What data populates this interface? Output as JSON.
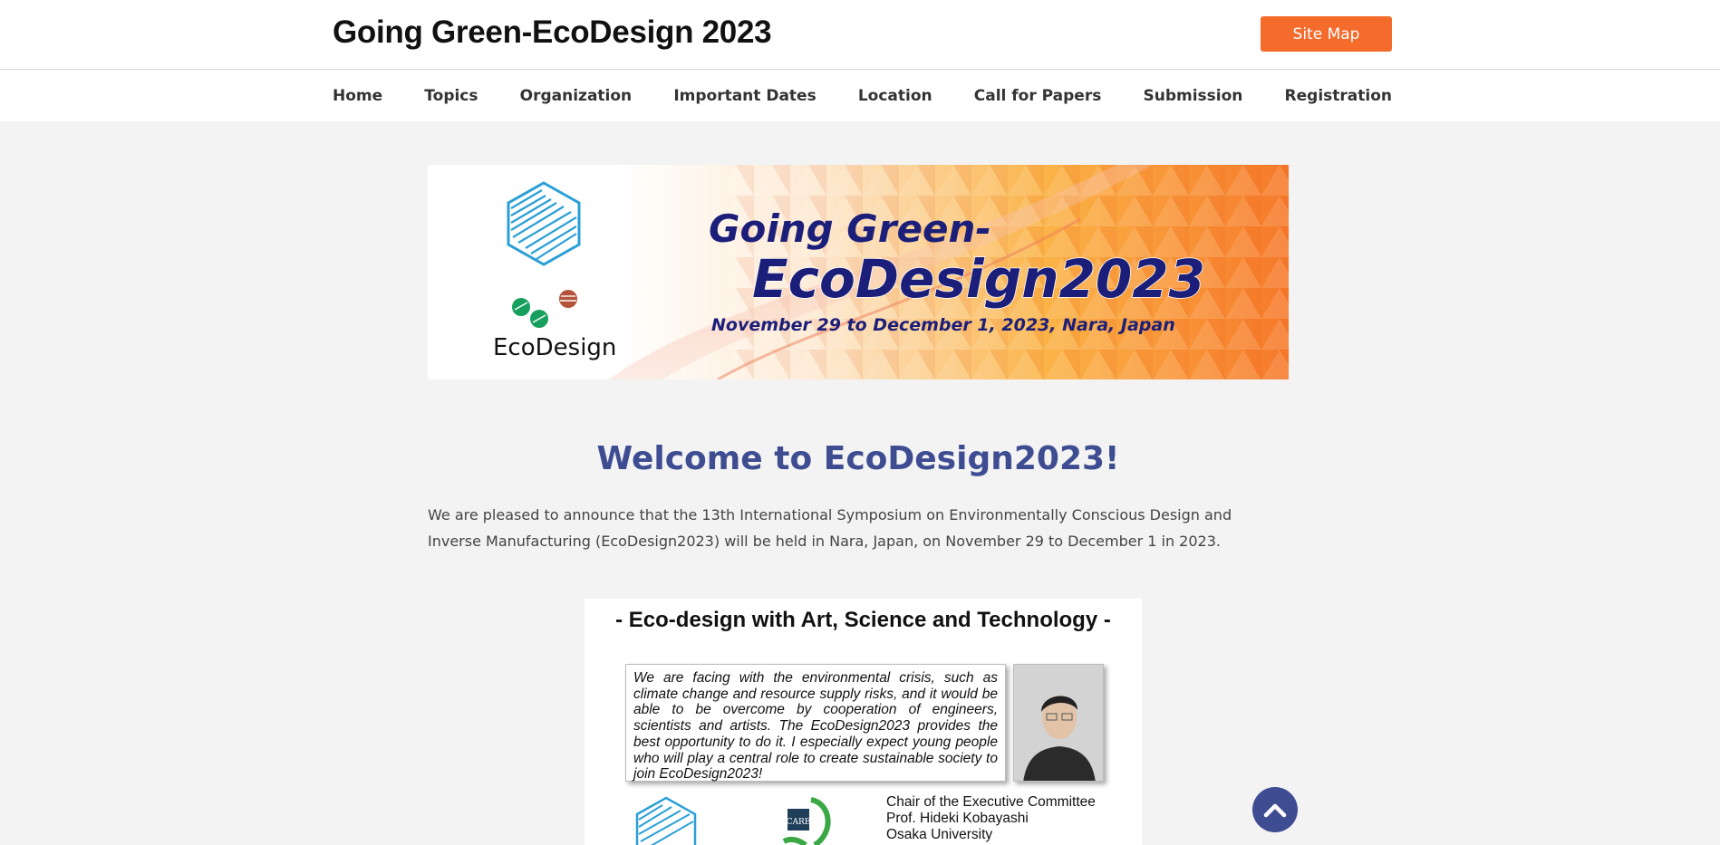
{
  "header": {
    "site_title": "Going Green-EcoDesign 2023",
    "sitemap_label": "Site Map"
  },
  "nav": {
    "items": [
      {
        "label": "Home"
      },
      {
        "label": "Topics"
      },
      {
        "label": "Organization"
      },
      {
        "label": "Important Dates"
      },
      {
        "label": "Location"
      },
      {
        "label": "Call for Papers"
      },
      {
        "label": "Submission"
      },
      {
        "label": "Registration"
      }
    ]
  },
  "banner": {
    "line1": "Going Green-",
    "line2": "EcoDesign2023",
    "dates": "November 29 to December 1, 2023, Nara, Japan",
    "logo_text": "EcoDesign"
  },
  "main": {
    "welcome_title": "Welcome to EcoDesign2023!",
    "intro_text": "We are pleased to announce that the 13th International Symposium on Environmentally Conscious Design and Inverse Manufacturing (EcoDesign2023) will be held in Nara, Japan, on November 29 to December 1 in 2023."
  },
  "poster": {
    "heading": "- Eco-design with Art, Science and Technology -",
    "quote": "We are facing with the environmental crisis, such as climate change and resource supply risks, and it would be able to be overcome by cooperation of engineers, scientists and artists. The EcoDesign2023 provides the best opportunity to do it. I especially expect young people who will play a central role to create sustainable society to join EcoDesign2023!",
    "chair_role": "Chair of the Executive Committee",
    "chair_name": "Prof. Hideki Kobayashi",
    "chair_affiliation": "Osaka University",
    "care_logo_text": "CARE"
  },
  "icons": {
    "back_to_top": "chevron-up-icon"
  },
  "colors": {
    "accent_orange": "#f46b2c",
    "heading_blue": "#3e4c92",
    "banner_navy": "#1b1f7a"
  }
}
